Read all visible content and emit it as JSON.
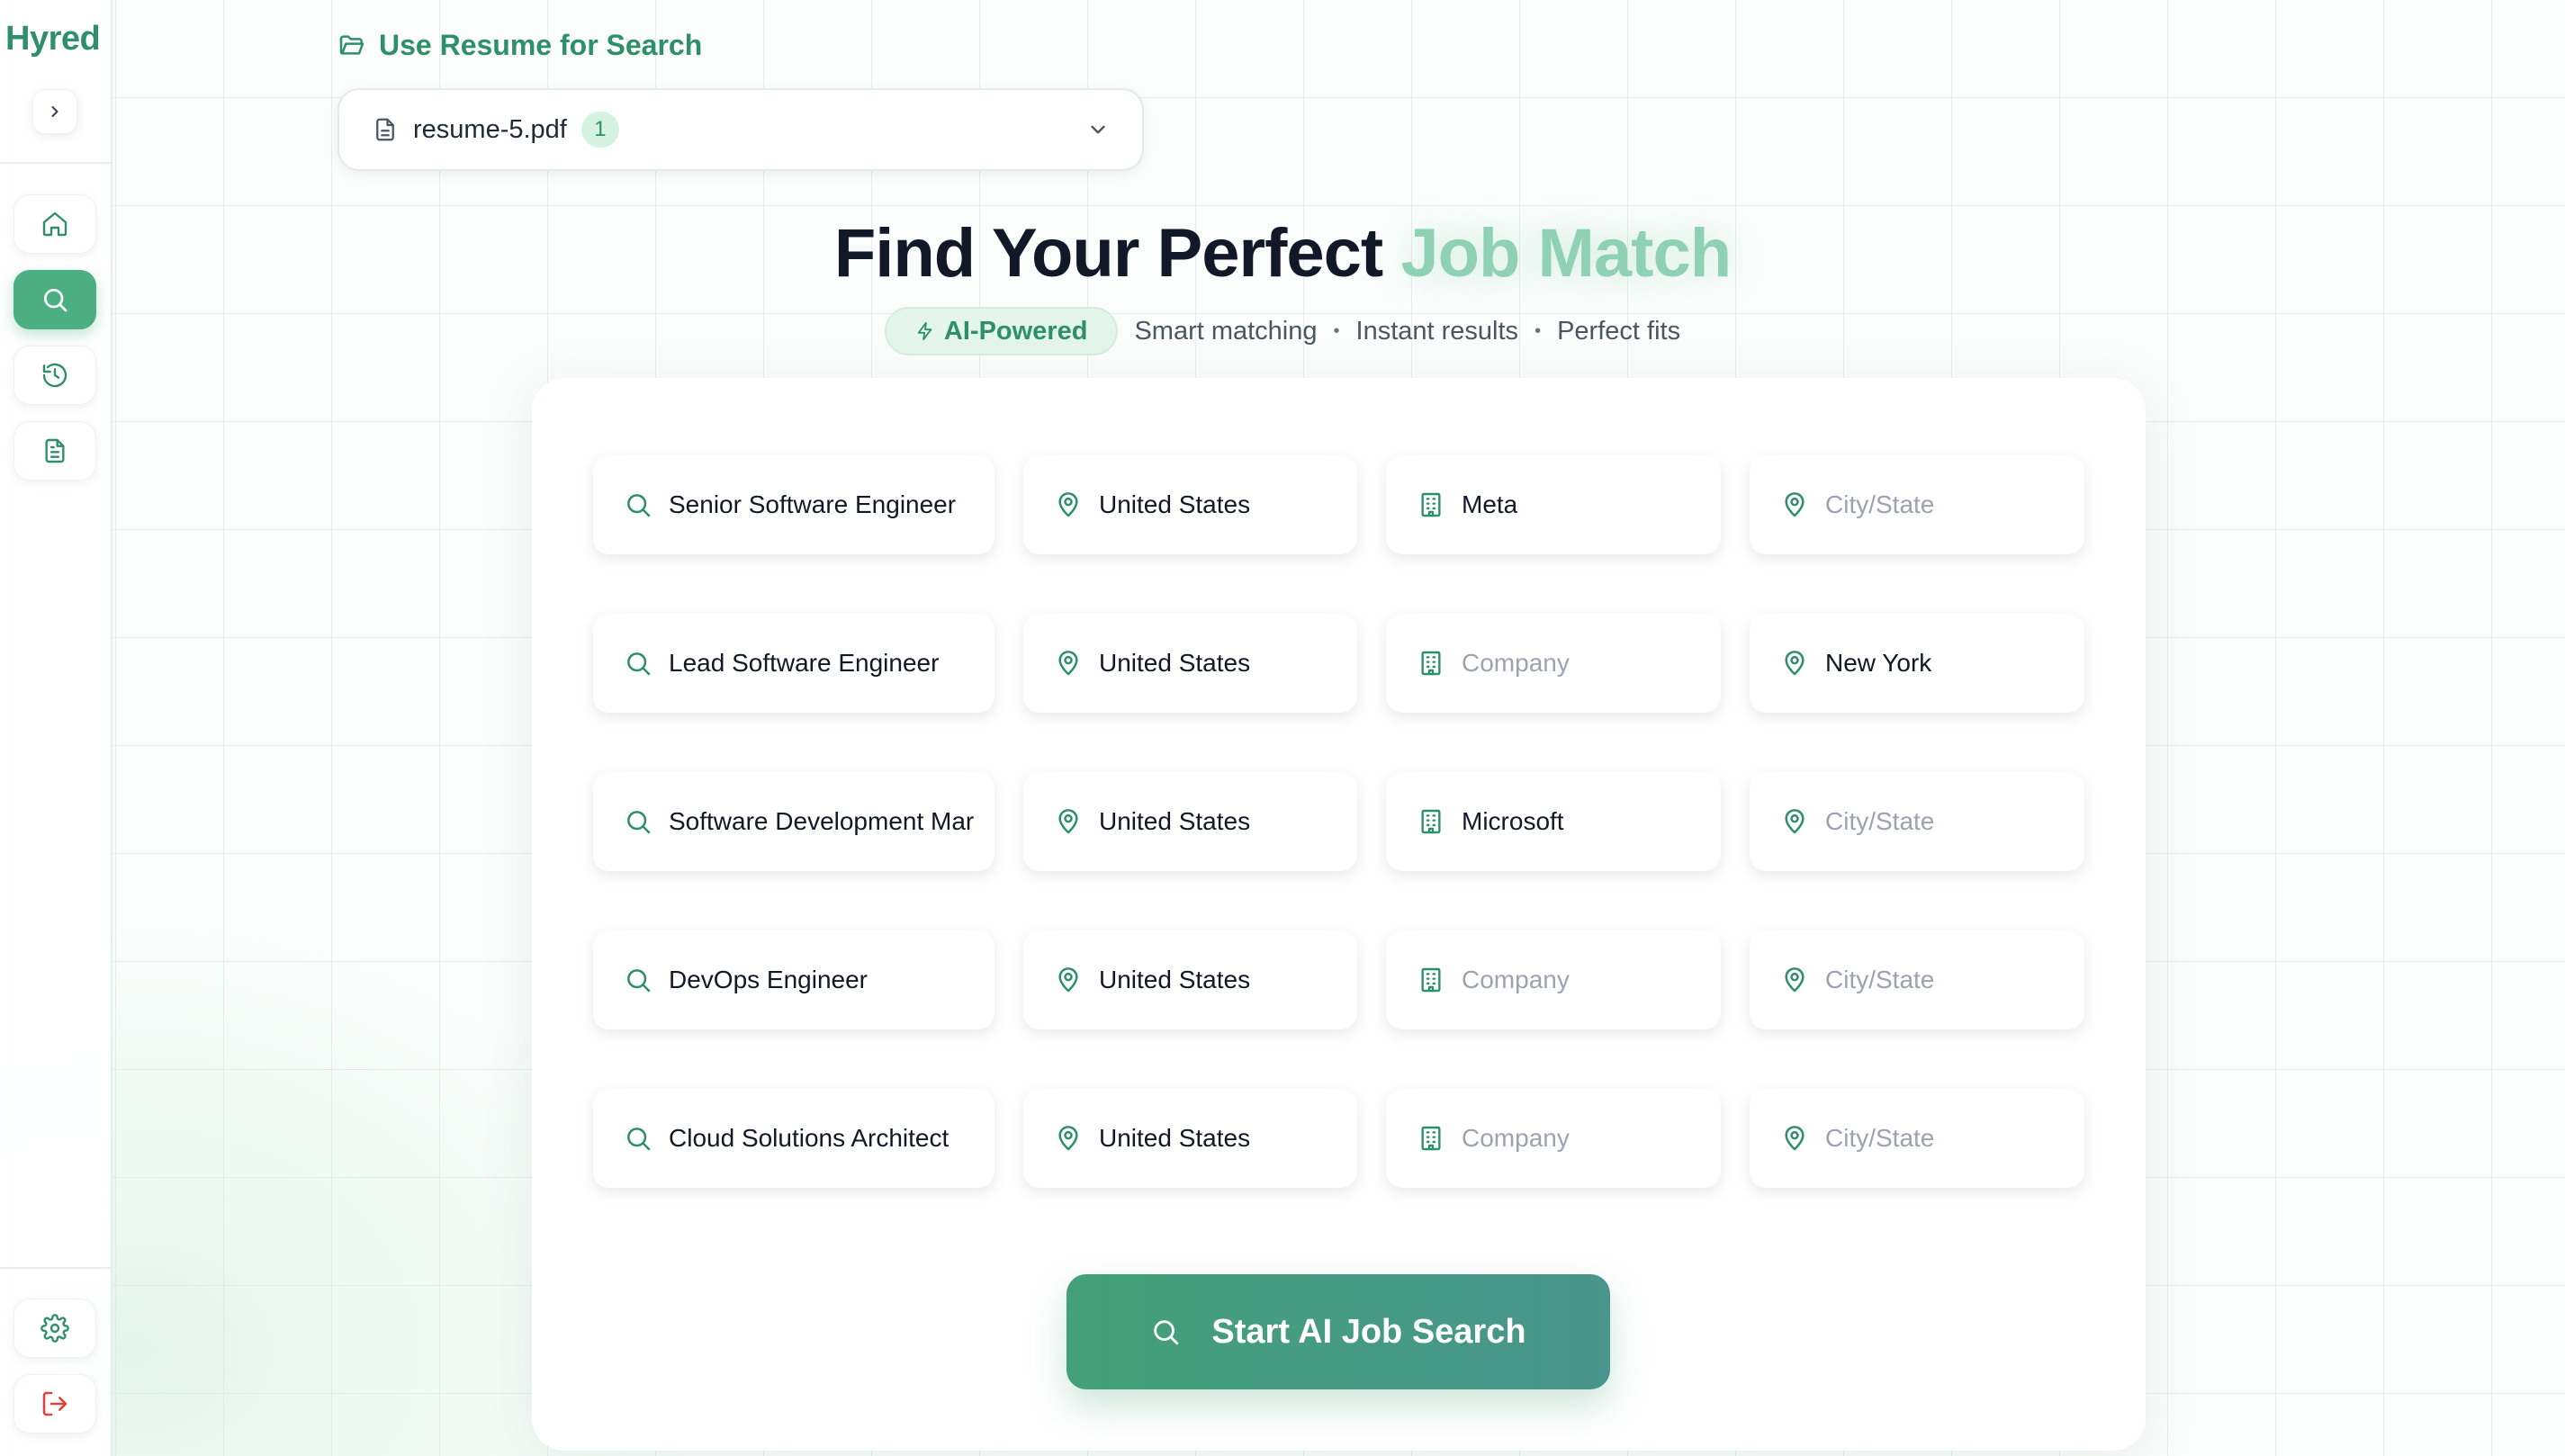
{
  "app": {
    "logo": "Hyred"
  },
  "sidebar": {
    "items": [
      {
        "name": "home",
        "icon": "home-icon"
      },
      {
        "name": "search",
        "icon": "search-icon",
        "active": true
      },
      {
        "name": "history",
        "icon": "history-icon"
      },
      {
        "name": "documents",
        "icon": "document-icon"
      }
    ],
    "bottom_items": [
      {
        "name": "settings",
        "icon": "gear-icon"
      },
      {
        "name": "logout",
        "icon": "logout-icon"
      }
    ]
  },
  "resume": {
    "label": "Use Resume for Search",
    "selected_file": "resume-5.pdf",
    "badge_count": "1"
  },
  "hero": {
    "title_main": "Find Your Perfect",
    "title_accent": "Job Match",
    "pill_label": "AI-Powered",
    "features": [
      "Smart matching",
      "Instant results",
      "Perfect fits"
    ]
  },
  "search_rows": [
    {
      "title": "Senior Software Engineer",
      "country": "United States",
      "company": "Meta",
      "city": ""
    },
    {
      "title": "Lead Software Engineer",
      "country": "United States",
      "company": "",
      "city": "New York"
    },
    {
      "title": "Software Development Mar",
      "country": "United States",
      "company": "Microsoft",
      "city": ""
    },
    {
      "title": "DevOps Engineer",
      "country": "United States",
      "company": "",
      "city": ""
    },
    {
      "title": "Cloud Solutions Architect",
      "country": "United States",
      "company": "",
      "city": ""
    }
  ],
  "placeholders": {
    "company": "Company",
    "city": "City/State"
  },
  "actions": {
    "start_search": "Start AI Job Search"
  },
  "colors": {
    "brand": "#2f8f6a",
    "active_nav": "#4caf82",
    "accent_title": "#8fd1b4",
    "logout": "#e0413a"
  }
}
